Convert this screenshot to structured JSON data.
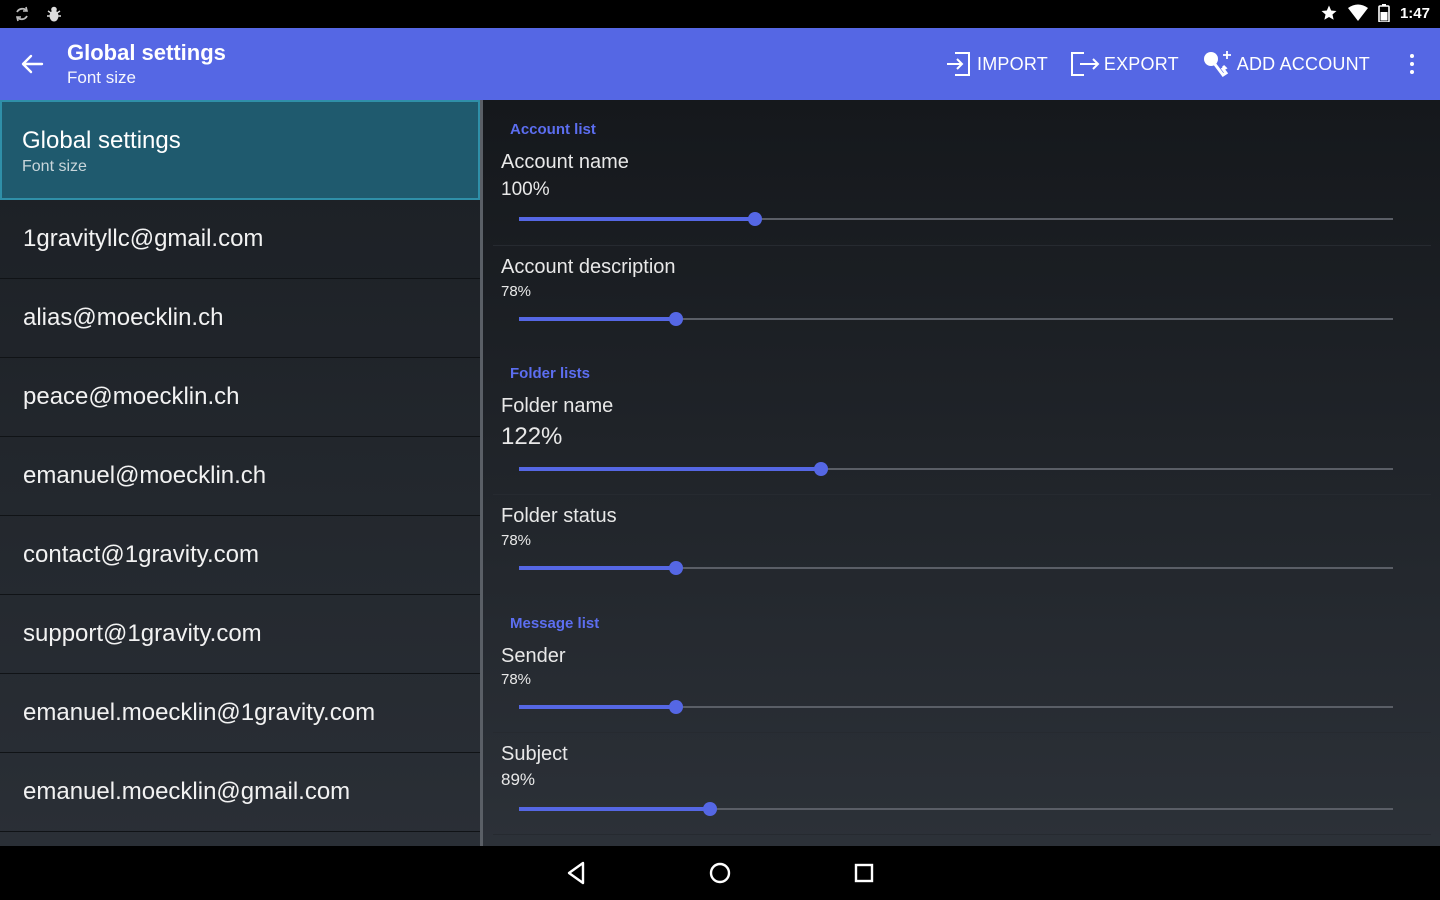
{
  "status_bar": {
    "time": "1:47",
    "left_icons": [
      "sync-icon",
      "bug-icon"
    ],
    "right_icons": [
      "star-icon",
      "wifi-icon",
      "battery-icon"
    ]
  },
  "app_bar": {
    "title": "Global settings",
    "subtitle": "Font size",
    "actions": [
      {
        "label": "IMPORT",
        "icon": "import-icon"
      },
      {
        "label": "EXPORT",
        "icon": "export-icon"
      },
      {
        "label": "ADD ACCOUNT",
        "icon": "add-account-icon"
      }
    ]
  },
  "sidebar": {
    "selected": {
      "title": "Global settings",
      "subtitle": "Font size"
    },
    "accounts": [
      "1gravityllc@gmail.com",
      "alias@moecklin.ch",
      "peace@moecklin.ch",
      "emanuel@moecklin.ch",
      "contact@1gravity.com",
      "support@1gravity.com",
      "emanuel.moecklin@1gravity.com",
      "emanuel.moecklin@gmail.com"
    ]
  },
  "settings": {
    "sections": [
      "Account list",
      "Folder lists",
      "Message list"
    ],
    "prefs": [
      {
        "name": "Account name",
        "value": "100%",
        "level": 0.27
      },
      {
        "name": "Account description",
        "value": "78%",
        "level": 0.18
      },
      {
        "name": "Folder name",
        "value": "122%",
        "level": 0.345
      },
      {
        "name": "Folder status",
        "value": "78%",
        "level": 0.18
      },
      {
        "name": "Sender",
        "value": "78%",
        "level": 0.18
      },
      {
        "name": "Subject",
        "value": "89%",
        "level": 0.218
      }
    ]
  },
  "colors": {
    "accent": "#5567e4",
    "selected_bg": "#1f5a6e",
    "section_header": "#5c6ef0"
  }
}
